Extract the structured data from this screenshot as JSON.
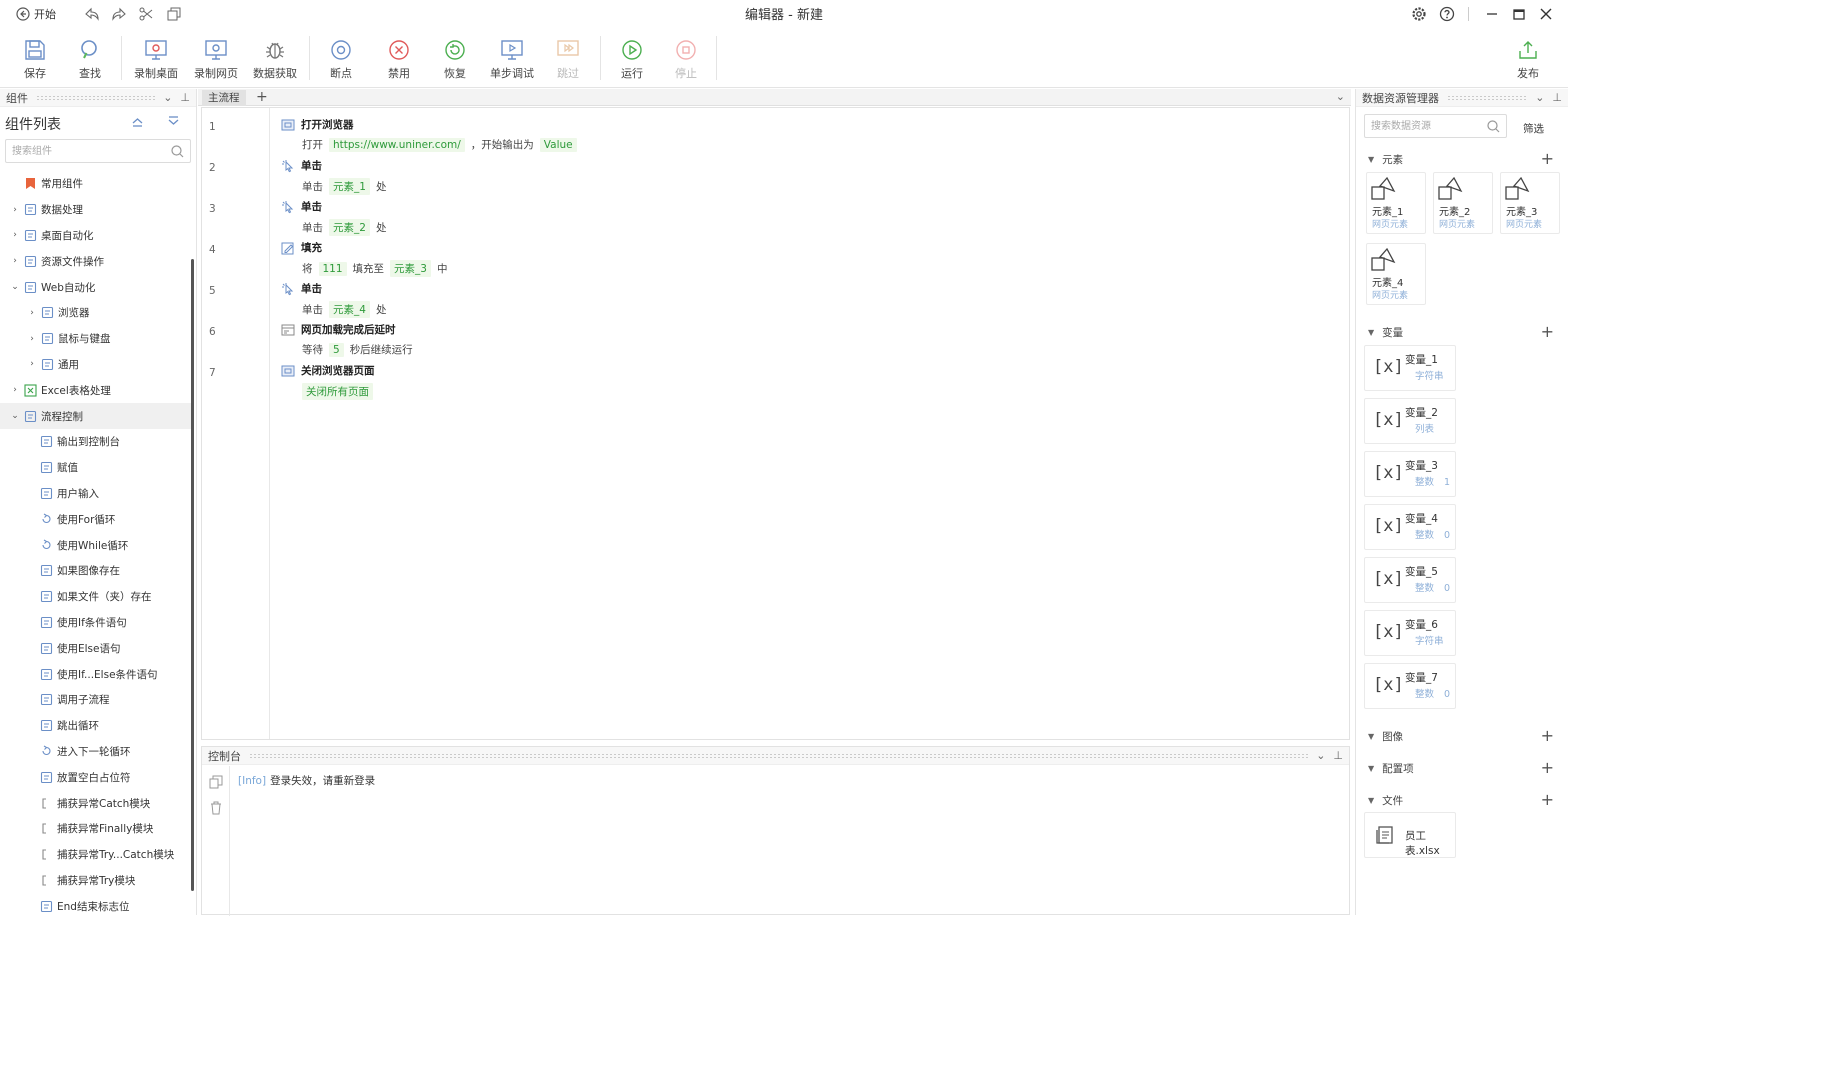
{
  "titlebar": {
    "back_label": "开始",
    "title": "编辑器 - 新建"
  },
  "toolbar": {
    "items": [
      {
        "label": "保存",
        "icon": "save-icon"
      },
      {
        "label": "查找",
        "icon": "search-icon"
      },
      {
        "label": "录制桌面",
        "icon": "record-desktop-icon"
      },
      {
        "label": "录制网页",
        "icon": "record-web-icon"
      },
      {
        "label": "数据获取",
        "icon": "data-capture-icon"
      },
      {
        "label": "断点",
        "icon": "breakpoint-icon"
      },
      {
        "label": "禁用",
        "icon": "disable-icon"
      },
      {
        "label": "恢复",
        "icon": "restore-icon"
      },
      {
        "label": "单步调试",
        "icon": "step-debug-icon"
      },
      {
        "label": "跳过",
        "icon": "skip-icon",
        "disabled": true
      },
      {
        "label": "运行",
        "icon": "run-icon"
      },
      {
        "label": "停止",
        "icon": "stop-icon",
        "disabled": true
      },
      {
        "label": "发布",
        "icon": "publish-icon"
      }
    ]
  },
  "left_panel": {
    "header": "组件",
    "title": "组件列表",
    "search_placeholder": "搜索组件",
    "tree": [
      {
        "label": "常用组件",
        "level": 0,
        "chevron": "",
        "icon": "bookmark-icon"
      },
      {
        "label": "数据处理",
        "level": 0,
        "chevron": "›",
        "icon": "table-icon"
      },
      {
        "label": "桌面自动化",
        "level": 0,
        "chevron": "›",
        "icon": "monitor-icon"
      },
      {
        "label": "资源文件操作",
        "level": 0,
        "chevron": "›",
        "icon": "folder-icon"
      },
      {
        "label": "Web自动化",
        "level": 0,
        "chevron": "⌄",
        "icon": "globe-icon"
      },
      {
        "label": "浏览器",
        "level": 1,
        "chevron": "›",
        "icon": "browser-icon"
      },
      {
        "label": "鼠标与键盘",
        "level": 1,
        "chevron": "›",
        "icon": "mouse-icon"
      },
      {
        "label": "通用",
        "level": 1,
        "chevron": "›",
        "icon": "generic-icon"
      },
      {
        "label": "Excel表格处理",
        "level": 0,
        "chevron": "›",
        "icon": "excel-icon"
      },
      {
        "label": "流程控制",
        "level": 0,
        "chevron": "⌄",
        "icon": "flow-icon",
        "selected": true
      },
      {
        "label": "输出到控制台",
        "level": 2,
        "chevron": "",
        "icon": "output-icon"
      },
      {
        "label": "赋值",
        "level": 2,
        "chevron": "",
        "icon": "assign-icon"
      },
      {
        "label": "用户输入",
        "level": 2,
        "chevron": "",
        "icon": "input-icon"
      },
      {
        "label": "使用For循环",
        "level": 2,
        "chevron": "",
        "icon": "loop-icon"
      },
      {
        "label": "使用While循环",
        "level": 2,
        "chevron": "",
        "icon": "loop-icon"
      },
      {
        "label": "如果图像存在",
        "level": 2,
        "chevron": "",
        "icon": "image-exists-icon"
      },
      {
        "label": "如果文件（夹）存在",
        "level": 2,
        "chevron": "",
        "icon": "file-exists-icon"
      },
      {
        "label": "使用If条件语句",
        "level": 2,
        "chevron": "",
        "icon": "if-icon"
      },
      {
        "label": "使用Else语句",
        "level": 2,
        "chevron": "",
        "icon": "else-icon"
      },
      {
        "label": "使用If...Else条件语句",
        "level": 2,
        "chevron": "",
        "icon": "if-else-icon"
      },
      {
        "label": "调用子流程",
        "level": 2,
        "chevron": "",
        "icon": "subflow-icon"
      },
      {
        "label": "跳出循环",
        "level": 2,
        "chevron": "",
        "icon": "break-icon"
      },
      {
        "label": "进入下一轮循环",
        "level": 2,
        "chevron": "",
        "icon": "loop-icon"
      },
      {
        "label": "放置空白占位符",
        "level": 2,
        "chevron": "",
        "icon": "placeholder-icon"
      },
      {
        "label": "捕获异常Catch模块",
        "level": 2,
        "chevron": "",
        "icon": "catch-icon"
      },
      {
        "label": "捕获异常Finally模块",
        "level": 2,
        "chevron": "",
        "icon": "catch-icon"
      },
      {
        "label": "捕获异常Try...Catch模块",
        "level": 2,
        "chevron": "",
        "icon": "catch-icon"
      },
      {
        "label": "捕获异常Try模块",
        "level": 2,
        "chevron": "",
        "icon": "catch-icon"
      },
      {
        "label": "End结束标志位",
        "level": 2,
        "chevron": "",
        "icon": "end-icon"
      }
    ]
  },
  "editor": {
    "tab": "主流程",
    "add_tab": "+",
    "steps": [
      {
        "line": "1",
        "title": "打开浏览器",
        "icon": "browser-icon",
        "parts": [
          {
            "t": "打开"
          },
          {
            "tag": "https://www.uniner.com/"
          },
          {
            "t": "，开始输出为"
          },
          {
            "tag": "Value"
          }
        ]
      },
      {
        "line": "2",
        "title": "单击",
        "icon": "click-icon",
        "parts": [
          {
            "t": "单击"
          },
          {
            "tag": "元素_1"
          },
          {
            "t": "处"
          }
        ]
      },
      {
        "line": "3",
        "title": "单击",
        "icon": "click-icon",
        "parts": [
          {
            "t": "单击"
          },
          {
            "tag": "元素_2"
          },
          {
            "t": "处"
          }
        ]
      },
      {
        "line": "4",
        "title": "填充",
        "icon": "fill-icon",
        "parts": [
          {
            "t": "将"
          },
          {
            "tag": "111"
          },
          {
            "t": "填充至"
          },
          {
            "tag": "元素_3"
          },
          {
            "t": "中"
          }
        ]
      },
      {
        "line": "5",
        "title": "单击",
        "icon": "click-icon",
        "parts": [
          {
            "t": "单击"
          },
          {
            "tag": "元素_4"
          },
          {
            "t": "处"
          }
        ]
      },
      {
        "line": "6",
        "title": "网页加载完成后延时",
        "icon": "delay-icon",
        "parts": [
          {
            "t": "等待"
          },
          {
            "tag": "5"
          },
          {
            "t": "秒后继续运行"
          }
        ]
      },
      {
        "line": "7",
        "title": "关闭浏览器页面",
        "icon": "browser-icon",
        "parts": [
          {
            "tag": "关闭所有页面"
          }
        ]
      }
    ]
  },
  "console": {
    "header": "控制台",
    "lines": [
      {
        "level": "[Info]",
        "text": "登录失效，请重新登录"
      }
    ]
  },
  "right_panel": {
    "header": "数据资源管理器",
    "search_placeholder": "搜索数据资源",
    "filter_label": "筛选",
    "sections": {
      "elements": "元素",
      "variables": "变量",
      "images": "图像",
      "config": "配置项",
      "files": "文件"
    },
    "elements": [
      {
        "name": "元素_1",
        "type": "网页元素"
      },
      {
        "name": "元素_2",
        "type": "网页元素"
      },
      {
        "name": "元素_3",
        "type": "网页元素"
      },
      {
        "name": "元素_4",
        "type": "网页元素"
      }
    ],
    "variables": [
      {
        "name": "变量_1",
        "type": "字符串",
        "value": ""
      },
      {
        "name": "变量_2",
        "type": "列表",
        "value": ""
      },
      {
        "name": "变量_3",
        "type": "整数",
        "value": "1"
      },
      {
        "name": "变量_4",
        "type": "整数",
        "value": "0"
      },
      {
        "name": "变量_5",
        "type": "整数",
        "value": "0"
      },
      {
        "name": "变量_6",
        "type": "字符串",
        "value": ""
      },
      {
        "name": "变量_7",
        "type": "整数",
        "value": "0"
      }
    ],
    "files": [
      {
        "name": "员工表.xlsx"
      }
    ]
  }
}
